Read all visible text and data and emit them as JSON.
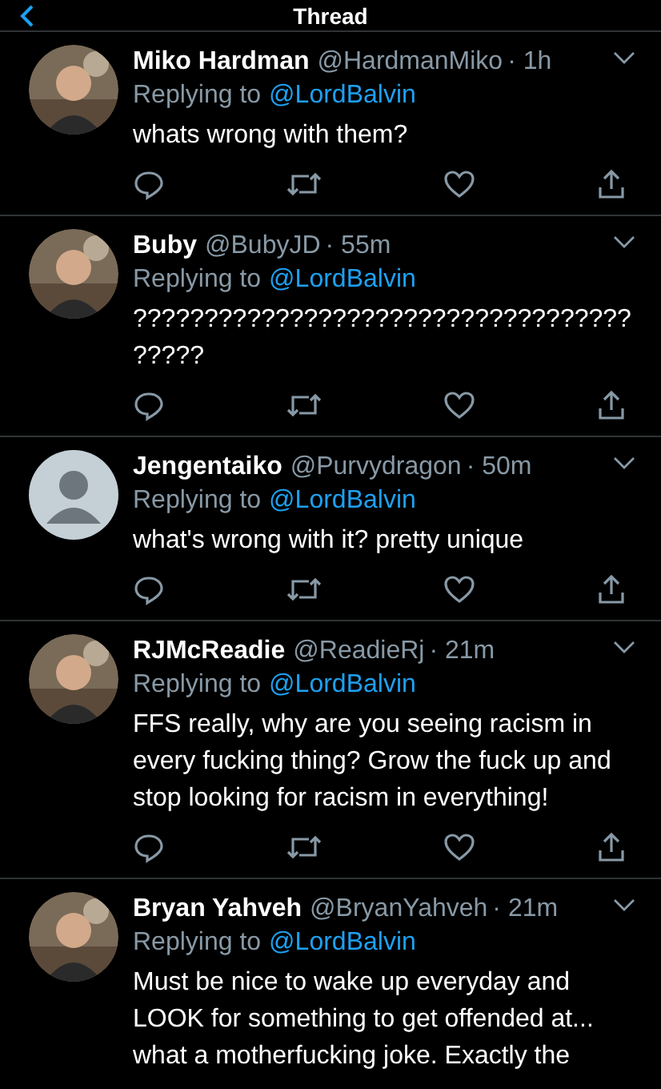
{
  "header": {
    "title": "Thread"
  },
  "tweets": [
    {
      "name": "Miko Hardman",
      "handle": "@HardmanMiko",
      "time": "· 1h",
      "replying_prefix": "Replying to",
      "replying_to": "@LordBalvin",
      "text": "whats wrong with them?",
      "actions_visible": true
    },
    {
      "name": "Buby",
      "handle": "@BubyJD",
      "time": "· 55m",
      "replying_prefix": "Replying to",
      "replying_to": "@LordBalvin",
      "text": "????????????????????????????????????????",
      "actions_visible": true
    },
    {
      "name": "Jengentaiko",
      "handle": "@Purvydragon",
      "time": "· 50m",
      "replying_prefix": "Replying to",
      "replying_to": "@LordBalvin",
      "text": "what's wrong with it? pretty unique",
      "avatar": {
        "kind": "default"
      },
      "actions_visible": true
    },
    {
      "name": "RJMcReadie",
      "handle": "@ReadieRj",
      "time": "· 21m",
      "replying_prefix": "Replying to",
      "replying_to": "@LordBalvin",
      "text": "FFS really, why are you seeing racism in every fucking thing? Grow the fuck up and stop looking for racism in everything!",
      "actions_visible": true
    },
    {
      "name": "Bryan Yahveh",
      "handle": "@BryanYahveh",
      "time": "· 21m",
      "replying_prefix": "Replying to",
      "replying_to": "@LordBalvin",
      "text": "Must be nice to wake up everyday and LOOK for something to get offended at... what a motherfucking joke. Exactly the",
      "actions_visible": false
    }
  ]
}
